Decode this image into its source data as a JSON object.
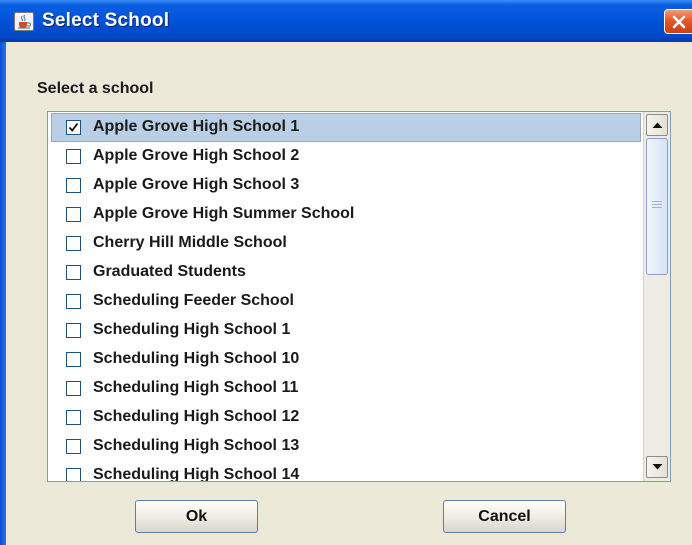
{
  "window": {
    "title": "Select School",
    "icon": "java-cup-icon"
  },
  "dialog": {
    "prompt": "Select a school"
  },
  "schools": [
    {
      "label": "Apple Grove High School 1",
      "checked": true
    },
    {
      "label": "Apple Grove High School 2",
      "checked": false
    },
    {
      "label": "Apple Grove High School 3",
      "checked": false
    },
    {
      "label": "Apple Grove High Summer School",
      "checked": false
    },
    {
      "label": "Cherry Hill Middle School",
      "checked": false
    },
    {
      "label": "Graduated Students",
      "checked": false
    },
    {
      "label": "Scheduling Feeder School",
      "checked": false
    },
    {
      "label": "Scheduling High School 1",
      "checked": false
    },
    {
      "label": "Scheduling High School 10",
      "checked": false
    },
    {
      "label": "Scheduling High School 11",
      "checked": false
    },
    {
      "label": "Scheduling High School 12",
      "checked": false
    },
    {
      "label": "Scheduling High School 13",
      "checked": false
    },
    {
      "label": "Scheduling High School 14",
      "checked": false
    }
  ],
  "buttons": {
    "ok": "Ok",
    "cancel": "Cancel"
  },
  "colors": {
    "title_bar": "#0152d8",
    "selection": "#b8cfe5",
    "dialog_bg": "#ece9d8"
  }
}
